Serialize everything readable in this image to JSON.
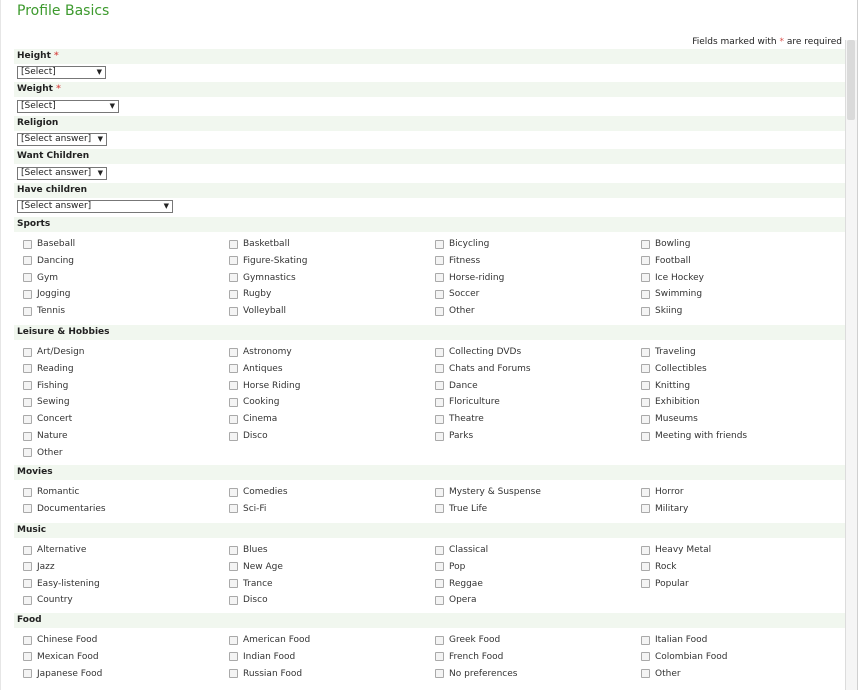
{
  "title": "Profile Basics",
  "required_note": {
    "prefix": "Fields marked with",
    "star": "*",
    "suffix": "are required"
  },
  "fields": {
    "height": {
      "label": "Height",
      "star": "*",
      "value": "[Select]"
    },
    "weight": {
      "label": "Weight",
      "star": "*",
      "value": "[Select]"
    },
    "religion": {
      "label": "Religion",
      "value": "[Select answer]"
    },
    "want_children": {
      "label": "Want Children",
      "value": "[Select answer]"
    },
    "have_children": {
      "label": "Have children",
      "value": "[Select answer]"
    }
  },
  "groups": [
    {
      "label": "Sports",
      "items": [
        "Baseball",
        "Basketball",
        "Bicycling",
        "Bowling",
        "Dancing",
        "Figure-Skating",
        "Fitness",
        "Football",
        "Gym",
        "Gymnastics",
        "Horse-riding",
        "Ice Hockey",
        "Jogging",
        "Rugby",
        "Soccer",
        "Swimming",
        "Tennis",
        "Volleyball",
        "Other",
        "Skiing"
      ]
    },
    {
      "label": "Leisure & Hobbies",
      "items": [
        "Art/Design",
        "Astronomy",
        "Collecting DVDs",
        "Traveling",
        "Reading",
        "Antiques",
        "Chats and Forums",
        "Collectibles",
        "Fishing",
        "Horse Riding",
        "Dance",
        "Knitting",
        "Sewing",
        "Cooking",
        "Floriculture",
        "Exhibition",
        "Concert",
        "Cinema",
        "Theatre",
        "Museums",
        "Nature",
        "Disco",
        "Parks",
        "Meeting with friends",
        "Other"
      ]
    },
    {
      "label": "Movies",
      "items": [
        "Romantic",
        "Comedies",
        "Mystery & Suspense",
        "Horror",
        "Documentaries",
        "Sci-Fi",
        "True Life",
        "Military"
      ]
    },
    {
      "label": "Music",
      "items": [
        "Alternative",
        "Blues",
        "Classical",
        "Heavy Metal",
        "Jazz",
        "New Age",
        "Pop",
        "Rock",
        "Easy-listening",
        "Trance",
        "Reggae",
        "Popular",
        "Country",
        "Disco",
        "Opera"
      ]
    },
    {
      "label": "Food",
      "items": [
        "Chinese Food",
        "American Food",
        "Greek Food",
        "Italian Food",
        "Mexican Food",
        "Indian Food",
        "French Food",
        "Colombian Food",
        "Japanese Food",
        "Russian Food",
        "No preferences",
        "Other"
      ]
    }
  ],
  "icons": {
    "dropdown": "triangle-down-icon",
    "checkbox": "checkbox-icon"
  },
  "colors": {
    "title": "#3d9a2e",
    "required_star": "#d9534f",
    "band": "#f1f7ef"
  }
}
